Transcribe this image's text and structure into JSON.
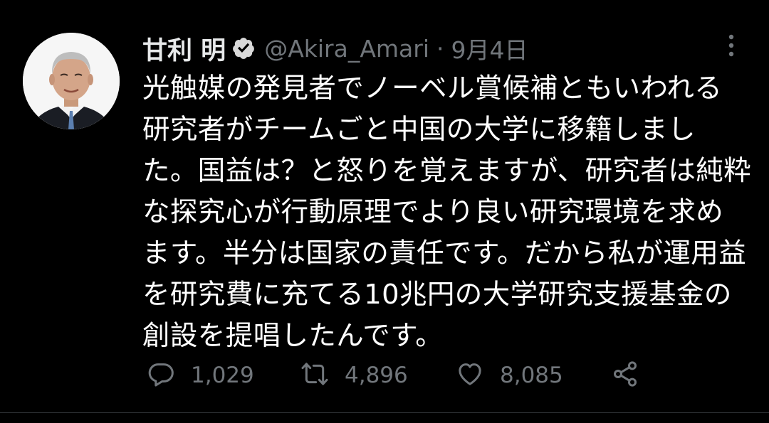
{
  "tweet": {
    "author": {
      "name": "甘利 明",
      "handle": "@Akira_Amari",
      "verified": true
    },
    "separator": "·",
    "date": "9月4日",
    "text_lines": [
      "光触媒の発見者でノーベル賞候補ともいわれる",
      "研究者がチームごと中国の大学に移籍しまし",
      "た。国益は？と怒りを覚えますが、研究者は純粋",
      "な探究心が行動原理でより良い研究環境を求め",
      "ます。半分は国家の責任です。だから私が運用益",
      "を研究費に充てる10兆円の大学研究支援基金の",
      "創設を提唱したんです。"
    ],
    "actions": {
      "reply_count": "1,029",
      "retweet_count": "4,896",
      "like_count": "8,085"
    }
  },
  "icons": {
    "verified": "verified-badge-icon",
    "more": "more-vertical-icon",
    "reply": "reply-icon",
    "retweet": "retweet-icon",
    "like": "heart-icon",
    "share": "share-icon"
  },
  "colors": {
    "background": "#000000",
    "text": "#ffffff",
    "secondary": "#71767b"
  }
}
